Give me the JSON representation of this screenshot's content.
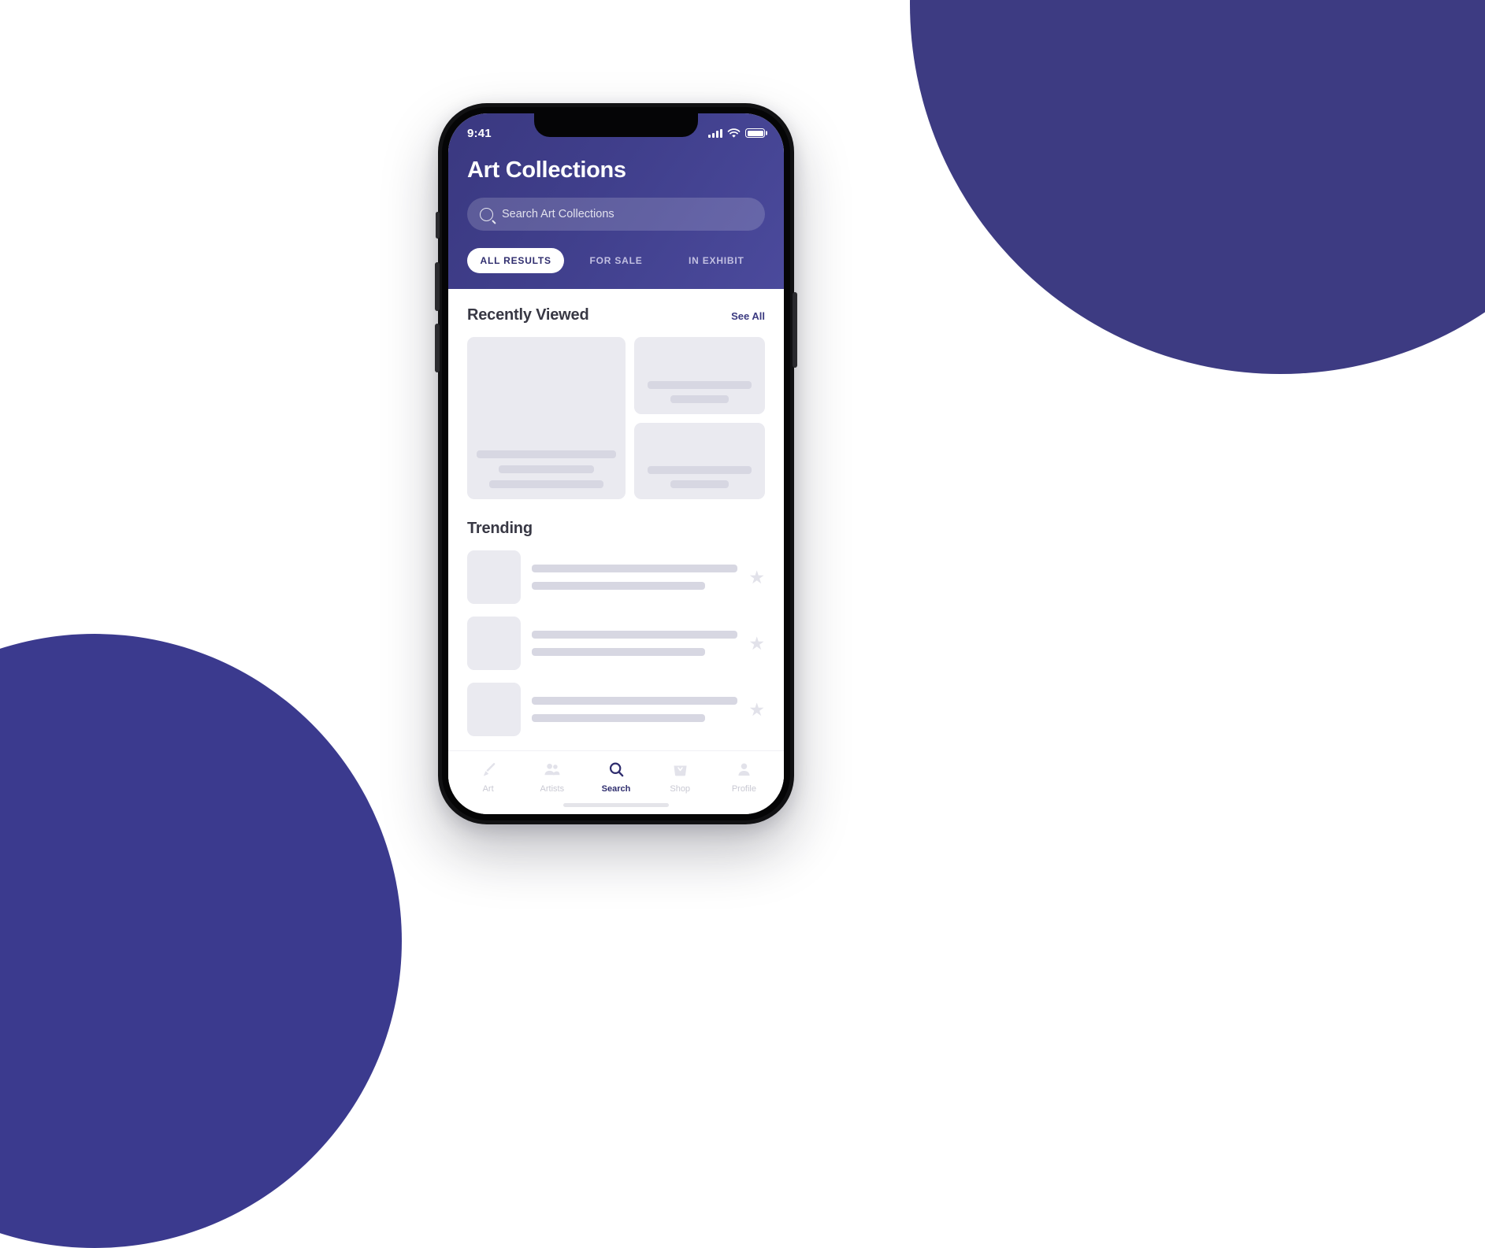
{
  "theme": {
    "header_gradient_start": "#3a3880",
    "header_gradient_end": "#4b4a9c",
    "accent": "#2f2d6e",
    "blob_top_right": "#3d3b82",
    "blob_bottom_left": "#3b3a8e",
    "skeleton_block": "#eaeaf0",
    "skeleton_bar": "#d7d7e2"
  },
  "status_bar": {
    "time": "9:41",
    "signal_icon": "signal-bars-icon",
    "wifi_icon": "wifi-icon",
    "battery_icon": "battery-full-icon"
  },
  "header": {
    "title": "Art Collections"
  },
  "search": {
    "icon": "search-icon",
    "placeholder": "Search Art Collections",
    "value": ""
  },
  "segmented_tabs": [
    {
      "label": "ALL RESULTS",
      "active": true
    },
    {
      "label": "FOR SALE",
      "active": false
    },
    {
      "label": "IN EXHIBIT",
      "active": false
    }
  ],
  "recently_viewed": {
    "title": "Recently Viewed",
    "see_all_label": "See All"
  },
  "trending": {
    "title": "Trending",
    "star_icon": "star-icon"
  },
  "tab_bar": [
    {
      "label": "Art",
      "icon": "paintbrush-icon",
      "active": false
    },
    {
      "label": "Artists",
      "icon": "people-icon",
      "active": false
    },
    {
      "label": "Search",
      "icon": "search-icon",
      "active": true
    },
    {
      "label": "Shop",
      "icon": "shopping-basket-icon",
      "active": false
    },
    {
      "label": "Profile",
      "icon": "person-icon",
      "active": false
    }
  ]
}
